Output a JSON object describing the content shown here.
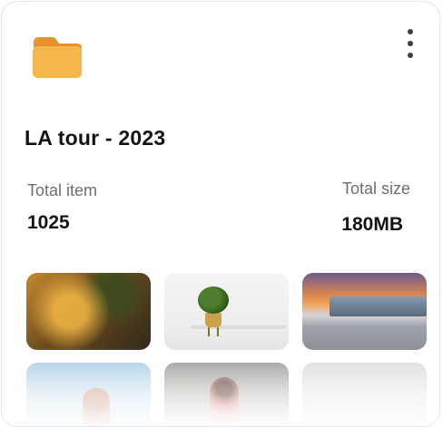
{
  "folder": {
    "icon": "folder-icon",
    "color": "#F5B74C",
    "menu_icon": "more-vertical-icon",
    "title": "LA tour - 2023"
  },
  "stats": {
    "total_item_label": "Total item",
    "total_item_value": "1025",
    "total_size_label": "Total size",
    "total_size_value": "180MB"
  },
  "thumbnails": [
    {
      "name": "warm-sunlight-photo"
    },
    {
      "name": "potted-plant-photo"
    },
    {
      "name": "sunset-building-photo"
    },
    {
      "name": "sky-portrait-photo"
    },
    {
      "name": "office-woman-photo"
    },
    {
      "name": "white-room-photo"
    }
  ]
}
